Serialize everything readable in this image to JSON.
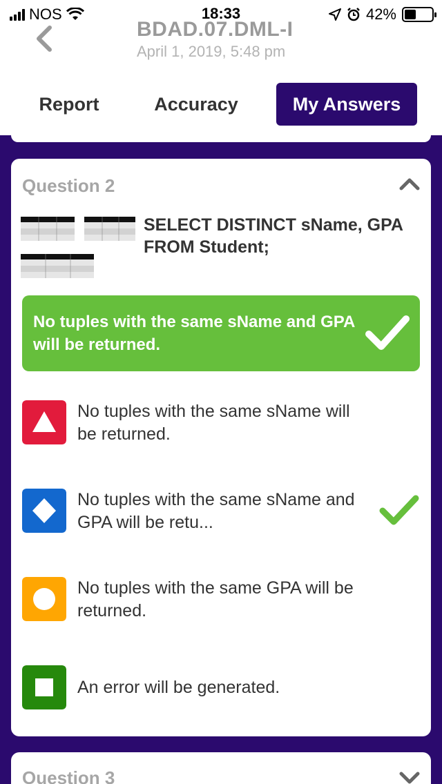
{
  "status_bar": {
    "carrier": "NOS",
    "time": "18:33",
    "battery": "42%",
    "battery_level": 0.42
  },
  "header": {
    "title": "BDAD.07.DML-I",
    "subtitle": "April 1, 2019, 5:48 pm"
  },
  "tabs": [
    {
      "label": "Report"
    },
    {
      "label": "Accuracy"
    },
    {
      "label": "My Answers",
      "active": true
    }
  ],
  "question": {
    "title": "Question 2",
    "text": "SELECT DISTINCT sName, GPA FROM Student;",
    "correct_answer": "No tuples with the same sName and GPA will be returned.",
    "options": [
      {
        "shape": "triangle",
        "color": "#e21b3c",
        "text": "No tuples with the same sName will be returned."
      },
      {
        "shape": "diamond",
        "color": "#1368ce",
        "text": "No tuples with the same sName and GPA will be retu...",
        "selected": true
      },
      {
        "shape": "circle",
        "color": "#ffa602",
        "text": "No tuples with the same GPA will be returned."
      },
      {
        "shape": "square",
        "color": "#26890c",
        "text": "An error will be generated."
      }
    ]
  },
  "next_question": {
    "title": "Question 3"
  },
  "colors": {
    "brand": "#2b0a6e",
    "correct": "#66bf3c",
    "check": "#66bf3c"
  }
}
